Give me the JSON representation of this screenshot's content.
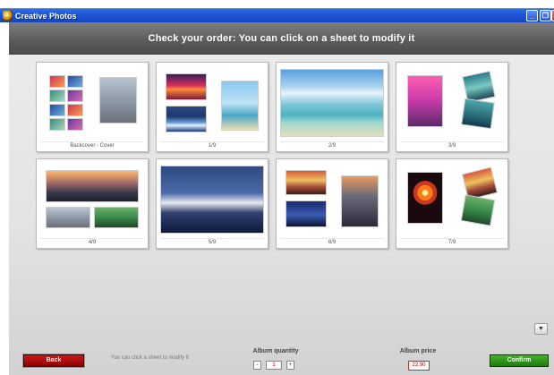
{
  "window": {
    "title": "Creative Photos",
    "minimize": "_",
    "maximize": "❐",
    "close": "×"
  },
  "header": {
    "title": "Check your order: You can click on a sheet to modify it"
  },
  "sheets": [
    {
      "label": "Backcover - Cover"
    },
    {
      "label": "1/9"
    },
    {
      "label": "2/9"
    },
    {
      "label": "3/9"
    },
    {
      "label": "4/9"
    },
    {
      "label": "5/9"
    },
    {
      "label": "6/9"
    },
    {
      "label": "7/9"
    }
  ],
  "footer": {
    "back_label": "Back",
    "hint": "You can click a sheet to modify it",
    "quantity_label": "Album quantity",
    "quantity_minus": "-",
    "quantity_value": "1",
    "quantity_plus": "+",
    "price_label": "Album price",
    "price_value": "22,90",
    "confirm_label": "Confirm",
    "scroll_icon": "▼"
  },
  "colors": {
    "back_button": "#b00000",
    "confirm_button": "#2e8f18",
    "header_band": "#5b5b5b",
    "title_bar": "#1b54d6"
  },
  "icons": [
    "app-icon",
    "minimize-icon",
    "maximize-icon",
    "close-icon",
    "scroll-down-icon"
  ]
}
